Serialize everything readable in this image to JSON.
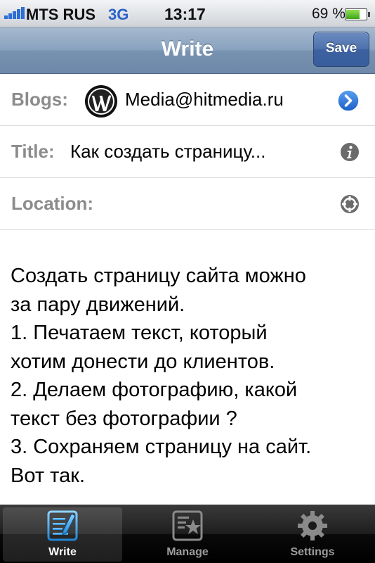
{
  "status_bar": {
    "carrier": "MTS RUS",
    "network": "3G",
    "time": "13:17",
    "battery": "69 %",
    "battery_level": 0.69
  },
  "nav": {
    "title": "Write",
    "save_label": "Save"
  },
  "form": {
    "blogs": {
      "label": "Blogs:",
      "value": "Media@hitmedia.ru",
      "icon": "wordpress-logo"
    },
    "title": {
      "label": "Title:",
      "value": "Как создать  страницу..."
    },
    "location": {
      "label": "Location:"
    }
  },
  "content": {
    "lines": [
      "Создать страницу сайта можно",
      "за пару движений.",
      "1. Печатаем текст, который",
      "хотим донести до клиентов.",
      "2. Делаем фотографию, какой",
      "текст без фотографии ?",
      "3. Сохраняем страницу на сайт.",
      "Вот так."
    ]
  },
  "tabs": [
    {
      "label": "Write",
      "icon": "write-icon",
      "active": true
    },
    {
      "label": "Manage",
      "icon": "manage-icon",
      "active": false
    },
    {
      "label": "Settings",
      "icon": "gear-icon",
      "active": false
    }
  ],
  "colors": {
    "nav_bar": "#7f99b8",
    "save_button": "#4569a6",
    "label_gray": "#8c8c8c",
    "disclosure_blue": "#2a70d6",
    "tab_bar": "#1a1a1a",
    "active_tab_icon": "#3aa3e6"
  }
}
